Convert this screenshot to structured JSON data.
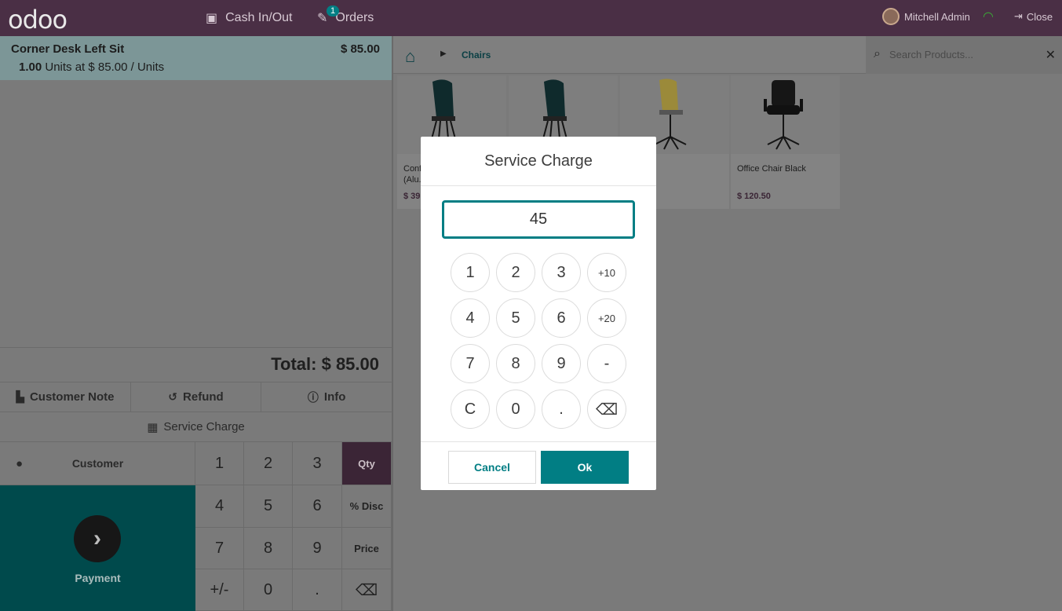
{
  "topbar": {
    "logo": "odoo",
    "cash_in_out": "Cash In/Out",
    "orders": "Orders",
    "orders_badge": "1",
    "user": "Mitchell Admin",
    "close": "Close"
  },
  "order": {
    "line_name": "Corner Desk Left Sit",
    "line_price": "$ 85.00",
    "line_qty": "1.00",
    "line_detail": "Units at $ 85.00 / Units",
    "total": "Total: $ 85.00"
  },
  "controls": {
    "customer_note": "Customer Note",
    "refund": "Refund",
    "info": "Info",
    "service_charge": "Service Charge",
    "customer": "Customer",
    "payment": "Payment"
  },
  "numpad": {
    "keys": [
      "1",
      "2",
      "3",
      "Qty",
      "4",
      "5",
      "6",
      "% Disc",
      "7",
      "8",
      "9",
      "Price",
      "+/-",
      "0",
      ".",
      "⌫"
    ],
    "active_mode": "Qty"
  },
  "products_header": {
    "breadcrumb": "Chairs",
    "search_placeholder": "Search Products..."
  },
  "products": [
    {
      "name": "Conf...",
      "name2": "(Alu...",
      "price": "$ 39..."
    },
    {
      "name": "",
      "name2": "",
      "price": ""
    },
    {
      "name": "...hair",
      "name2": "",
      "price": ""
    },
    {
      "name": "Office Chair Black",
      "name2": "",
      "price": "$ 120.50"
    }
  ],
  "modal": {
    "title": "Service Charge",
    "value": "45",
    "keys": [
      "1",
      "2",
      "3",
      "+10",
      "4",
      "5",
      "6",
      "+20",
      "7",
      "8",
      "9",
      "-",
      "C",
      "0",
      ".",
      "⌫"
    ],
    "cancel": "Cancel",
    "ok": "Ok"
  },
  "colors": {
    "topbar": "#4a2f45",
    "accent": "#017e84",
    "payment": "#004a4c"
  }
}
